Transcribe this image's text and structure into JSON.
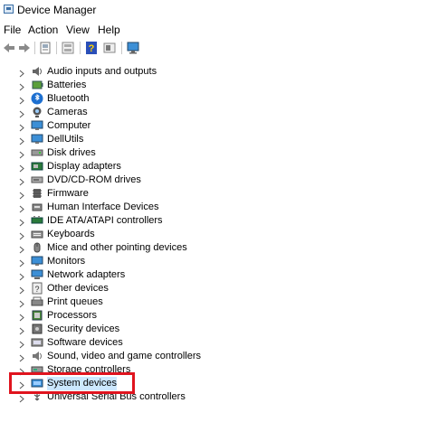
{
  "window": {
    "title": "Device Manager"
  },
  "menu": [
    "File",
    "Action",
    "View",
    "Help"
  ],
  "toolbar": [
    {
      "icon": "back-arrow-icon"
    },
    {
      "icon": "forward-arrow-icon"
    },
    {
      "icon": "properties-icon"
    },
    {
      "icon": "show-hidden-icon"
    },
    {
      "icon": "help-icon"
    },
    {
      "icon": "update-driver-icon"
    },
    {
      "icon": "monitor-scan-icon"
    }
  ],
  "tree": {
    "items": [
      {
        "label": "Audio inputs and outputs",
        "icon": "speaker-icon"
      },
      {
        "label": "Batteries",
        "icon": "battery-icon"
      },
      {
        "label": "Bluetooth",
        "icon": "bluetooth-icon"
      },
      {
        "label": "Cameras",
        "icon": "camera-icon"
      },
      {
        "label": "Computer",
        "icon": "computer-icon"
      },
      {
        "label": "DellUtils",
        "icon": "dellutils-icon"
      },
      {
        "label": "Disk drives",
        "icon": "disk-drive-icon"
      },
      {
        "label": "Display adapters",
        "icon": "display-adapter-icon"
      },
      {
        "label": "DVD/CD-ROM drives",
        "icon": "dvd-drive-icon"
      },
      {
        "label": "Firmware",
        "icon": "firmware-icon"
      },
      {
        "label": "Human Interface Devices",
        "icon": "hid-icon"
      },
      {
        "label": "IDE ATA/ATAPI controllers",
        "icon": "ide-controller-icon"
      },
      {
        "label": "Keyboards",
        "icon": "keyboard-icon"
      },
      {
        "label": "Mice and other pointing devices",
        "icon": "mouse-icon"
      },
      {
        "label": "Monitors",
        "icon": "monitor-icon"
      },
      {
        "label": "Network adapters",
        "icon": "network-adapter-icon"
      },
      {
        "label": "Other devices",
        "icon": "other-devices-icon"
      },
      {
        "label": "Print queues",
        "icon": "printer-icon"
      },
      {
        "label": "Processors",
        "icon": "processor-icon"
      },
      {
        "label": "Security devices",
        "icon": "security-device-icon"
      },
      {
        "label": "Software devices",
        "icon": "software-device-icon"
      },
      {
        "label": "Sound, video and game controllers",
        "icon": "sound-controller-icon"
      },
      {
        "label": "Storage controllers",
        "icon": "storage-controller-icon"
      },
      {
        "label": "System devices",
        "icon": "system-devices-icon",
        "selected": true
      },
      {
        "label": "Universal Serial Bus controllers",
        "icon": "usb-icon"
      }
    ]
  },
  "colors": {
    "selection": "#cce8ff",
    "highlight_box": "#e0141e"
  }
}
